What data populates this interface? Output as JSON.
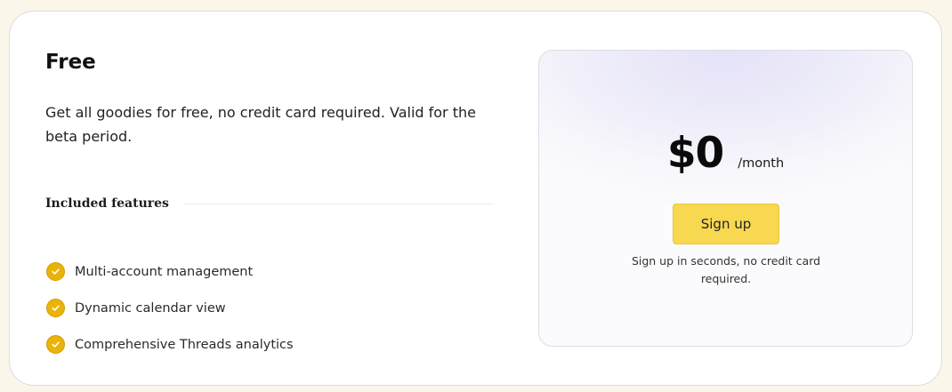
{
  "plan": {
    "title": "Free",
    "description": "Get all goodies for free, no credit card required. Valid for the beta period.",
    "features_label": "Included features",
    "features": [
      {
        "label": "Multi-account management",
        "icon": "check-circle-icon"
      },
      {
        "label": "Dynamic calendar view",
        "icon": "check-circle-icon"
      },
      {
        "label": "Comprehensive Threads analytics",
        "icon": "check-circle-icon"
      }
    ]
  },
  "pricing": {
    "amount": "$0",
    "period": "/month",
    "cta_label": "Sign up",
    "cta_note": "Sign up in seconds, no credit card required."
  },
  "colors": {
    "accent": "#f8d851",
    "check": "#eab308",
    "page_background": "#fbf6ea"
  }
}
